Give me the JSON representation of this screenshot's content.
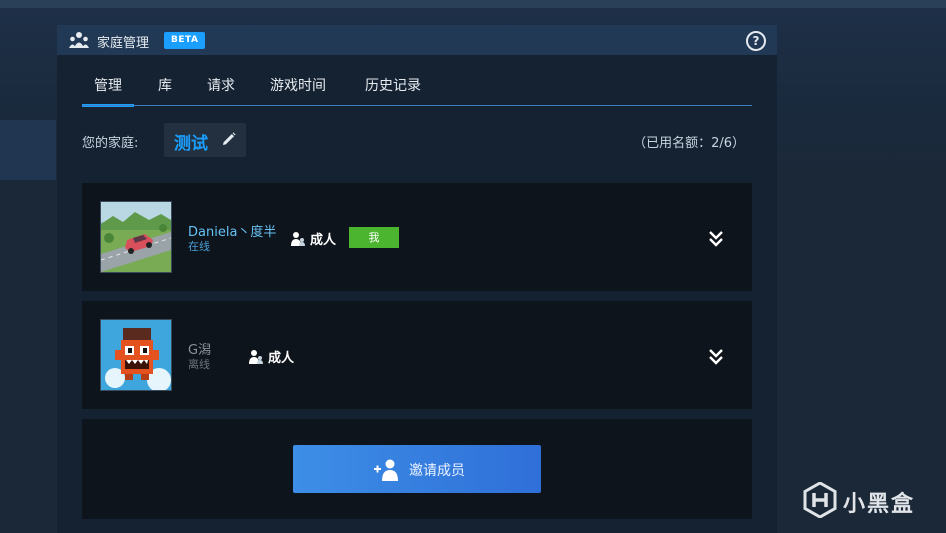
{
  "header": {
    "title": "家庭管理",
    "badge": "BETA",
    "help_symbol": "?"
  },
  "tabs": [
    {
      "label": "管理",
      "active": true
    },
    {
      "label": "库",
      "active": false
    },
    {
      "label": "请求",
      "active": false
    },
    {
      "label": "游戏时间",
      "active": false
    },
    {
      "label": "历史记录",
      "active": false
    }
  ],
  "family": {
    "label": "您的家庭:",
    "name": "测试",
    "slots": "（已用名额：2/6）"
  },
  "members": [
    {
      "name": "Daniela丶度半",
      "status": "在线",
      "role": "成人",
      "me_badge": "我",
      "name_color": "#67c1f5",
      "status_color": "#4a9fd6"
    },
    {
      "name": "G潟",
      "status": "离线",
      "role": "成人",
      "name_color": "#8b929a",
      "status_color": "#6b737b"
    }
  ],
  "invite": {
    "label": "邀请成员"
  },
  "watermark": {
    "text": "小黑盒"
  },
  "colors": {
    "accent": "#1a9fff",
    "me_badge": "#4bb530",
    "invite_button": "#3a86e3",
    "panel_bg": "#152232",
    "card_bg": "#0e141b"
  }
}
